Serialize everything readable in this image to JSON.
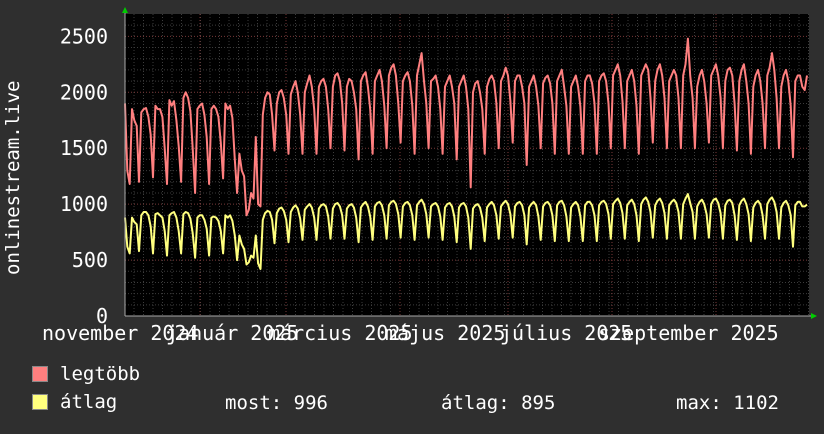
{
  "chart_data": {
    "type": "line",
    "ylabel": "onlinestream.live",
    "ylim": [
      0,
      2700
    ],
    "y_ticks": [
      0,
      500,
      1000,
      1500,
      2000,
      2500
    ],
    "x_tick_labels": [
      "november 2024",
      "január 2025",
      "március 2025",
      "május 2025",
      "július 2025",
      "szeptember 2025"
    ],
    "grid": true,
    "series": [
      {
        "name": "legtöbb",
        "color": "#ff7f7f",
        "values": [
          1900,
          1300,
          1180,
          1850,
          1750,
          1700,
          1200,
          1820,
          1850,
          1860,
          1780,
          1620,
          1240,
          1880,
          1850,
          1850,
          1780,
          1500,
          1180,
          1930,
          1880,
          1920,
          1750,
          1520,
          1200,
          1950,
          2000,
          1950,
          1830,
          1500,
          1100,
          1850,
          1880,
          1900,
          1800,
          1600,
          1180,
          1850,
          1880,
          1850,
          1780,
          1550,
          1230,
          1900,
          1850,
          1880,
          1770,
          1400,
          1100,
          1450,
          1300,
          1250,
          900,
          950,
          1100,
          1050,
          1600,
          1000,
          980,
          1800,
          1950,
          2000,
          1980,
          1800,
          1480,
          1900,
          2000,
          2020,
          1950,
          1800,
          1450,
          1980,
          2050,
          2100,
          2000,
          1800,
          1450,
          2000,
          2080,
          2150,
          2050,
          1850,
          1450,
          2050,
          2100,
          2120,
          2050,
          1850,
          1500,
          2050,
          2150,
          2170,
          2100,
          1900,
          1480,
          2050,
          2120,
          2100,
          2000,
          1850,
          1400,
          2100,
          2150,
          2180,
          2050,
          1850,
          1450,
          2100,
          2150,
          2200,
          2100,
          1880,
          1500,
          2150,
          2220,
          2250,
          2150,
          1900,
          1550,
          2100,
          2150,
          2180,
          2100,
          1880,
          1450,
          2150,
          2250,
          2350,
          2100,
          1900,
          1500,
          2100,
          2120,
          2150,
          2050,
          1850,
          1450,
          2050,
          2100,
          2150,
          2050,
          1900,
          1400,
          2050,
          2100,
          2150,
          2050,
          1850,
          1150,
          2000,
          2080,
          2100,
          2000,
          1850,
          1450,
          2050,
          2120,
          2150,
          2100,
          1900,
          1500,
          2100,
          2150,
          2220,
          2150,
          1920,
          1550,
          2100,
          2150,
          2150,
          2050,
          1900,
          1350,
          2050,
          2100,
          2150,
          2050,
          1880,
          1500,
          2080,
          2130,
          2150,
          2080,
          1900,
          1450,
          2100,
          2150,
          2200,
          2050,
          1880,
          1450,
          2050,
          2100,
          2150,
          2050,
          1870,
          1450,
          2100,
          2150,
          2150,
          2080,
          1900,
          1450,
          2100,
          2150,
          2170,
          2100,
          1900,
          1500,
          2150,
          2200,
          2250,
          2150,
          1920,
          1500,
          2100,
          2150,
          2200,
          2100,
          1880,
          1450,
          2150,
          2200,
          2250,
          2200,
          1950,
          1550,
          2100,
          2200,
          2250,
          2150,
          1950,
          1500,
          2100,
          2150,
          2200,
          2150,
          1950,
          1500,
          2150,
          2250,
          2480,
          2150,
          1950,
          1500,
          2050,
          2150,
          2200,
          2100,
          1900,
          1550,
          2150,
          2200,
          2250,
          2150,
          1950,
          1500,
          2100,
          2200,
          2220,
          2150,
          1900,
          1480,
          2100,
          2200,
          2250,
          2100,
          1900,
          1450,
          2050,
          2150,
          2200,
          2100,
          1900,
          1500,
          2150,
          2220,
          2350,
          2200,
          1950,
          1500,
          2050,
          2150,
          2200,
          2100,
          1880,
          1420,
          2100,
          2150,
          2150,
          2050,
          2020,
          2150
        ]
      },
      {
        "name": "átlag",
        "color": "#ffff7f",
        "values": [
          880,
          620,
          560,
          880,
          840,
          820,
          580,
          900,
          930,
          930,
          900,
          800,
          560,
          910,
          920,
          900,
          880,
          760,
          540,
          900,
          920,
          930,
          880,
          760,
          560,
          910,
          930,
          920,
          870,
          740,
          520,
          880,
          900,
          900,
          860,
          780,
          540,
          880,
          890,
          880,
          850,
          760,
          560,
          900,
          880,
          900,
          850,
          720,
          500,
          720,
          640,
          600,
          460,
          480,
          540,
          520,
          720,
          470,
          420,
          860,
          920,
          940,
          930,
          860,
          650,
          920,
          960,
          970,
          940,
          860,
          660,
          930,
          970,
          990,
          960,
          870,
          680,
          950,
          980,
          1000,
          970,
          880,
          680,
          960,
          990,
          1000,
          980,
          890,
          690,
          960,
          1000,
          1010,
          980,
          900,
          690,
          960,
          990,
          1000,
          970,
          880,
          660,
          970,
          1000,
          1020,
          980,
          890,
          680,
          980,
          1010,
          1020,
          990,
          900,
          690,
          990,
          1020,
          1030,
          1000,
          910,
          700,
          980,
          1010,
          1020,
          990,
          900,
          680,
          990,
          1020,
          1040,
          1000,
          910,
          700,
          980,
          1000,
          1010,
          980,
          890,
          680,
          970,
          1000,
          1010,
          980,
          890,
          660,
          970,
          1000,
          1010,
          980,
          880,
          600,
          960,
          990,
          1000,
          970,
          880,
          670,
          970,
          1000,
          1020,
          990,
          900,
          690,
          980,
          1010,
          1030,
          1000,
          910,
          700,
          980,
          1010,
          1020,
          990,
          900,
          640,
          970,
          1000,
          1020,
          990,
          890,
          680,
          980,
          1010,
          1020,
          990,
          900,
          670,
          990,
          1020,
          1030,
          990,
          890,
          670,
          970,
          1000,
          1020,
          990,
          890,
          670,
          990,
          1020,
          1020,
          990,
          900,
          670,
          990,
          1020,
          1030,
          1000,
          910,
          690,
          1000,
          1030,
          1050,
          1010,
          920,
          690,
          990,
          1020,
          1040,
          1000,
          900,
          670,
          1000,
          1040,
          1060,
          1020,
          930,
          700,
          990,
          1030,
          1050,
          1010,
          920,
          690,
          990,
          1020,
          1040,
          1010,
          930,
          690,
          1000,
          1050,
          1090,
          1010,
          930,
          690,
          980,
          1020,
          1040,
          1000,
          910,
          700,
          1000,
          1040,
          1050,
          1010,
          920,
          690,
          990,
          1030,
          1040,
          1010,
          900,
          680,
          990,
          1030,
          1050,
          1000,
          910,
          670,
          970,
          1010,
          1030,
          1000,
          900,
          690,
          1000,
          1040,
          1060,
          1020,
          930,
          690,
          970,
          1010,
          1030,
          990,
          900,
          620,
          990,
          1020,
          1020,
          980,
          980,
          996
        ]
      }
    ]
  },
  "legend": [
    {
      "label": "legtöbb",
      "color": "#ff7f7f"
    },
    {
      "label": "átlag",
      "color": "#ffff7f"
    }
  ],
  "stats": {
    "now": "most: 996",
    "avg": "átlag: 895",
    "max": "max: 1102"
  }
}
